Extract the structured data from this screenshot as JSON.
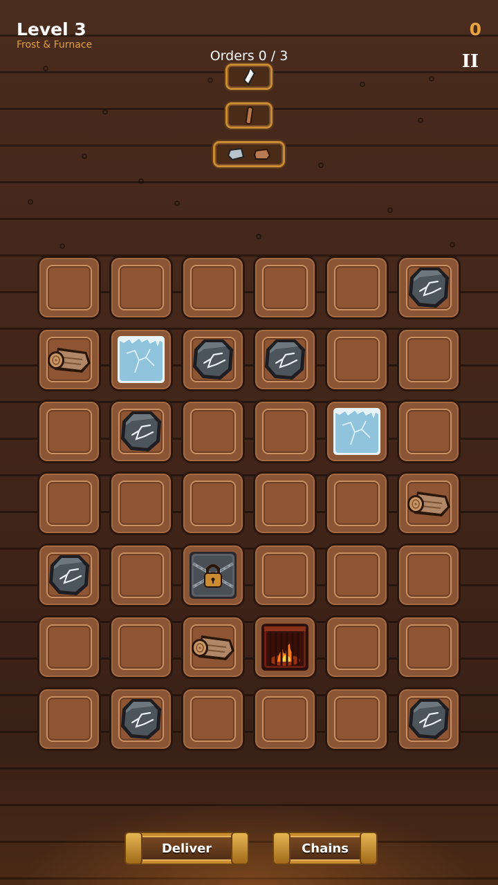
{
  "hud": {
    "level_title": "Level 3",
    "level_subtitle": "Frost & Furnace",
    "score": "0",
    "pause_symbol": "II"
  },
  "orders": {
    "label": "Orders 0 / 3",
    "slots": [
      {
        "items": [
          "crystal-shard-icon"
        ]
      },
      {
        "items": [
          "wooden-stick-icon"
        ]
      },
      {
        "items": [
          "metal-ingot-icon",
          "copper-ingot-icon"
        ]
      }
    ]
  },
  "board": {
    "rows": 7,
    "cols": 6,
    "tiles": [
      [
        "empty",
        "empty",
        "empty",
        "empty",
        "empty",
        "rock"
      ],
      [
        "log",
        "ice",
        "rock",
        "rock",
        "empty",
        "empty"
      ],
      [
        "empty",
        "rock",
        "empty",
        "empty",
        "ice",
        "empty"
      ],
      [
        "empty",
        "empty",
        "empty",
        "empty",
        "empty",
        "log"
      ],
      [
        "rock",
        "empty",
        "chained-crate",
        "empty",
        "empty",
        "empty"
      ],
      [
        "empty",
        "empty",
        "log",
        "furnace",
        "empty",
        "empty"
      ],
      [
        "empty",
        "rock",
        "empty",
        "empty",
        "empty",
        "rock"
      ]
    ]
  },
  "buttons": {
    "deliver_label": "Deliver",
    "chains_label": "Chains"
  },
  "colors": {
    "accent": "#e8a341",
    "tile": "#8a5534",
    "ice": "#8fc4dc",
    "rock": "#4c545c"
  }
}
